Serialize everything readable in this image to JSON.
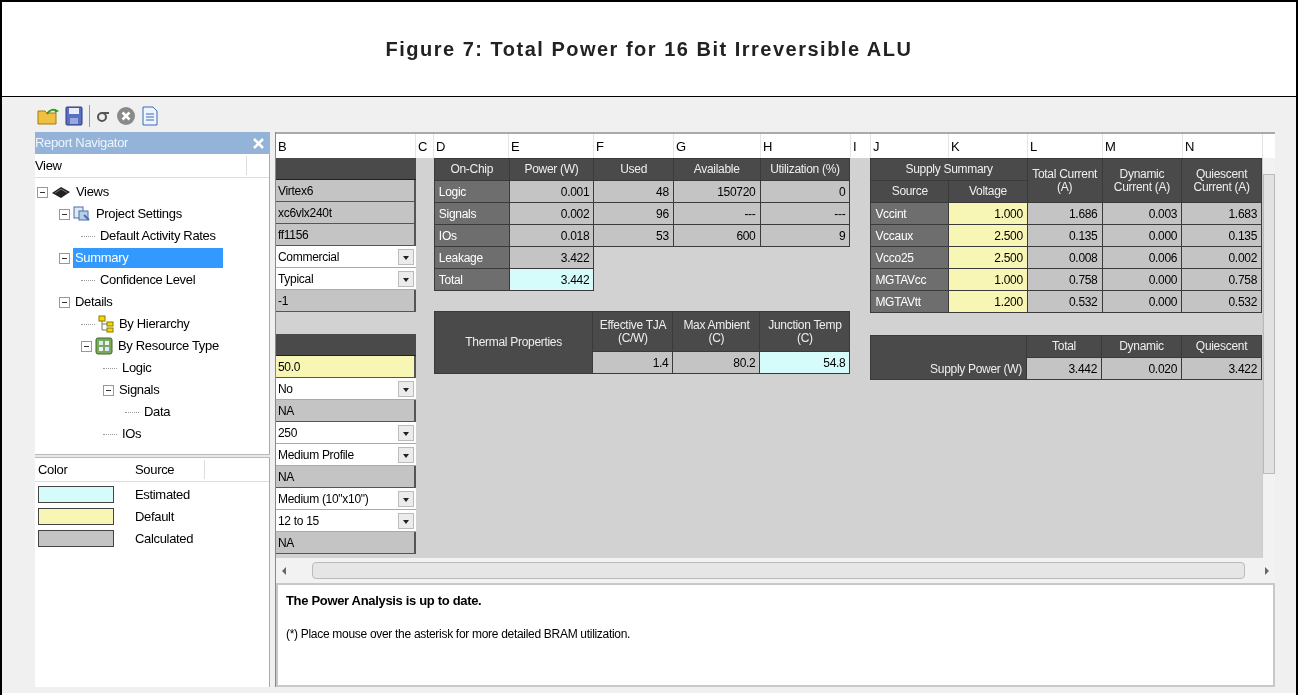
{
  "caption": "Figure 7: Total Power for 16 Bit Irreversible ALU",
  "navigator": {
    "title": "Report Navigator",
    "column": "View",
    "tree": [
      {
        "label": "Views",
        "kind": "chip",
        "expanded": true,
        "selected": false,
        "children": [
          {
            "label": "Project Settings",
            "kind": "settings",
            "expanded": true,
            "selected": false,
            "children": [
              {
                "label": "Default Activity Rates",
                "selected": false
              }
            ]
          },
          {
            "label": "Summary",
            "expanded": true,
            "selected": true,
            "children": [
              {
                "label": "Confidence Level",
                "selected": false
              }
            ]
          },
          {
            "label": "Details",
            "expanded": true,
            "selected": false,
            "children": [
              {
                "label": "By Hierarchy",
                "kind": "hierarchy",
                "selected": false
              },
              {
                "label": "By Resource Type",
                "kind": "resource",
                "expanded": true,
                "selected": false,
                "children": [
                  {
                    "label": "Logic",
                    "selected": false
                  },
                  {
                    "label": "Signals",
                    "expanded": true,
                    "selected": false,
                    "children": [
                      {
                        "label": "Data",
                        "selected": false
                      }
                    ]
                  },
                  {
                    "label": "IOs",
                    "selected": false
                  }
                ]
              }
            ]
          }
        ]
      }
    ]
  },
  "legend": {
    "columns": [
      "Color",
      "Source"
    ],
    "items": [
      {
        "label": "Estimated",
        "color": "#d6fbfb"
      },
      {
        "label": "Default",
        "color": "#f8f6b4"
      },
      {
        "label": "Calculated",
        "color": "#c4c4c4"
      }
    ]
  },
  "sheet": {
    "columns": [
      "B",
      "C",
      "D",
      "E",
      "F",
      "G",
      "H",
      "I",
      "J",
      "K",
      "L",
      "M",
      "N"
    ],
    "settings": [
      {
        "kind": "header"
      },
      {
        "kind": "calculated",
        "text": "Virtex6"
      },
      {
        "kind": "calculated",
        "text": "xc6vlx240t"
      },
      {
        "kind": "calculated",
        "text": "ff1156"
      },
      {
        "kind": "dropdown",
        "text": "Commercial"
      },
      {
        "kind": "dropdown",
        "text": "Typical"
      },
      {
        "kind": "calculated",
        "text": "-1"
      },
      {
        "kind": "gap"
      },
      {
        "kind": "header"
      },
      {
        "kind": "default",
        "text": "50.0"
      },
      {
        "kind": "dropdown",
        "text": "No"
      },
      {
        "kind": "calculated",
        "text": "NA"
      },
      {
        "kind": "dropdown",
        "text": "250"
      },
      {
        "kind": "dropdown",
        "text": "Medium Profile"
      },
      {
        "kind": "calculated",
        "text": "NA"
      },
      {
        "kind": "dropdown",
        "text": "Medium (10\"x10\")"
      },
      {
        "kind": "dropdown",
        "text": "12 to 15"
      },
      {
        "kind": "calculated",
        "text": "NA"
      }
    ],
    "on_chip": {
      "columns": [
        "On-Chip",
        "Power (W)",
        "Used",
        "Available",
        "Utilization (%)"
      ],
      "rows": [
        {
          "cells": [
            {
              "text": "Logic",
              "color": "#6e6e6e"
            },
            {
              "text": "0.001",
              "color": "#c4c4c4"
            },
            {
              "text": "48",
              "color": "#c4c4c4"
            },
            {
              "text": "150720",
              "color": "#c4c4c4"
            },
            {
              "text": "0",
              "color": "#c4c4c4"
            }
          ]
        },
        {
          "cells": [
            {
              "text": "Signals",
              "color": "#6e6e6e"
            },
            {
              "text": "0.002",
              "color": "#c4c4c4"
            },
            {
              "text": "96",
              "color": "#c4c4c4"
            },
            {
              "text": "---",
              "color": "#c4c4c4"
            },
            {
              "text": "---",
              "color": "#c4c4c4"
            }
          ]
        },
        {
          "cells": [
            {
              "text": "IOs",
              "color": "#6e6e6e"
            },
            {
              "text": "0.018",
              "color": "#c4c4c4"
            },
            {
              "text": "53",
              "color": "#c4c4c4"
            },
            {
              "text": "600",
              "color": "#c4c4c4"
            },
            {
              "text": "9",
              "color": "#c4c4c4"
            }
          ]
        },
        {
          "cells": [
            {
              "text": "Leakage",
              "color": "#6e6e6e"
            },
            {
              "text": "3.422",
              "color": "#c4c4c4"
            }
          ]
        },
        {
          "cells": [
            {
              "text": "Total",
              "color": "#6e6e6e"
            },
            {
              "text": "3.442",
              "color": "#d6fbfb"
            }
          ]
        }
      ]
    },
    "thermal": {
      "title": "Thermal  Properties",
      "columns": [
        "Effective TJA (C/W)",
        "Max Ambient (C)",
        "Junction Temp (C)"
      ],
      "values": [
        {
          "text": "1.4",
          "color": "#c4c4c4"
        },
        {
          "text": "80.2",
          "color": "#c4c4c4"
        },
        {
          "text": "54.8",
          "color": "#d6fbfb"
        }
      ]
    },
    "supply": {
      "title": "Supply Summary",
      "columns": [
        "Source",
        "Voltage",
        "Total Current (A)",
        "Dynamic Current (A)",
        "Quiescent Current (A)"
      ],
      "rows": [
        {
          "cells": [
            {
              "text": "Vccint",
              "color": "#6e6e6e"
            },
            {
              "text": "1.000",
              "color": "#f8f6b4"
            },
            {
              "text": "1.686",
              "color": "#c4c4c4"
            },
            {
              "text": "0.003",
              "color": "#c4c4c4"
            },
            {
              "text": "1.683",
              "color": "#c4c4c4"
            }
          ]
        },
        {
          "cells": [
            {
              "text": "Vccaux",
              "color": "#6e6e6e"
            },
            {
              "text": "2.500",
              "color": "#f8f6b4"
            },
            {
              "text": "0.135",
              "color": "#c4c4c4"
            },
            {
              "text": "0.000",
              "color": "#c4c4c4"
            },
            {
              "text": "0.135",
              "color": "#c4c4c4"
            }
          ]
        },
        {
          "cells": [
            {
              "text": "Vcco25",
              "color": "#6e6e6e"
            },
            {
              "text": "2.500",
              "color": "#f8f6b4"
            },
            {
              "text": "0.008",
              "color": "#c4c4c4"
            },
            {
              "text": "0.006",
              "color": "#c4c4c4"
            },
            {
              "text": "0.002",
              "color": "#c4c4c4"
            }
          ]
        },
        {
          "cells": [
            {
              "text": "MGTAVcc",
              "color": "#6e6e6e"
            },
            {
              "text": "1.000",
              "color": "#f8f6b4"
            },
            {
              "text": "0.758",
              "color": "#c4c4c4"
            },
            {
              "text": "0.000",
              "color": "#c4c4c4"
            },
            {
              "text": "0.758",
              "color": "#c4c4c4"
            }
          ]
        },
        {
          "cells": [
            {
              "text": "MGTAVtt",
              "color": "#6e6e6e"
            },
            {
              "text": "1.200",
              "color": "#f8f6b4"
            },
            {
              "text": "0.532",
              "color": "#c4c4c4"
            },
            {
              "text": "0.000",
              "color": "#c4c4c4"
            },
            {
              "text": "0.532",
              "color": "#c4c4c4"
            }
          ]
        }
      ]
    },
    "supply_power": {
      "title": "Supply Power (W)",
      "columns": [
        "Total",
        "Dynamic",
        "Quiescent"
      ],
      "values": [
        {
          "text": "3.442",
          "color": "#c4c4c4"
        },
        {
          "text": "0.020",
          "color": "#c4c4c4"
        },
        {
          "text": "3.422",
          "color": "#c4c4c4"
        }
      ]
    }
  },
  "status": {
    "message": "The Power Analysis is up to date.",
    "note": "(*) Place mouse over the asterisk for more detailed BRAM utilization."
  }
}
